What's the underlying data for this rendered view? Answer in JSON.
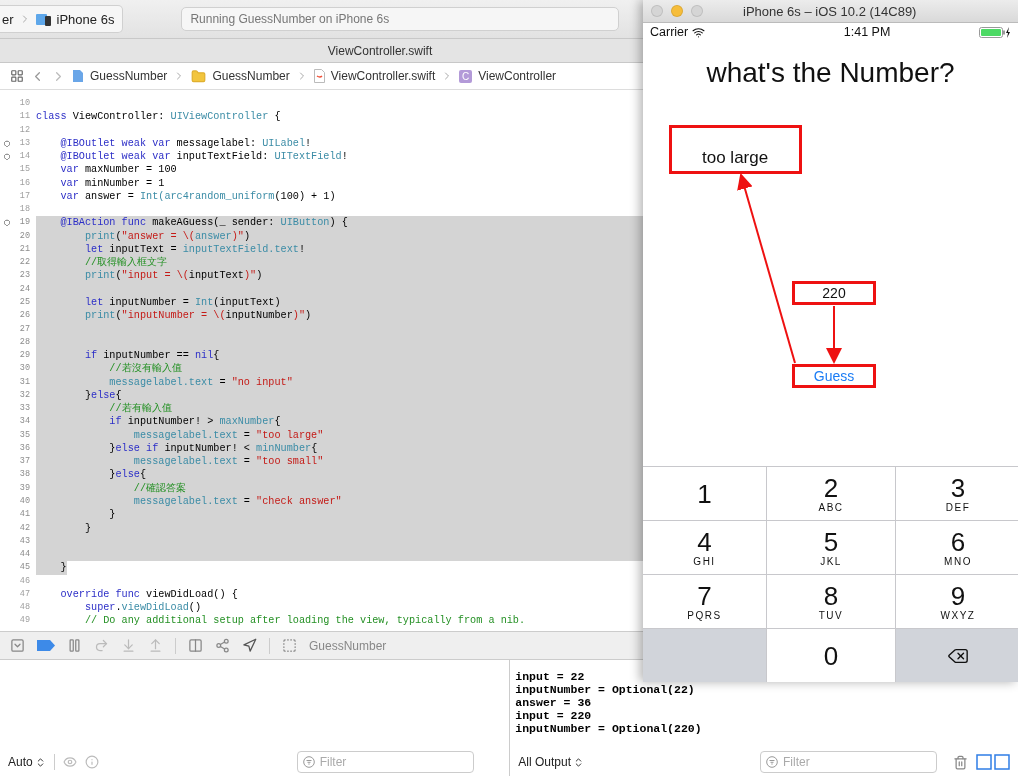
{
  "xcode": {
    "toolbar": {
      "scheme": [
        {
          "kind": "text",
          "label": "er"
        },
        {
          "kind": "device",
          "label": "iPhone 6s"
        }
      ],
      "activity": "Running GuessNumber on iPhone 6s"
    },
    "tab_title": "ViewController.swift",
    "jump_bar": [
      {
        "kind": "project",
        "label": "GuessNumber"
      },
      {
        "kind": "folder",
        "label": "GuessNumber"
      },
      {
        "kind": "file",
        "label": "ViewController.swift"
      },
      {
        "kind": "class",
        "label": "ViewController",
        "symbol": "C"
      }
    ],
    "editor": {
      "lines": [
        {
          "n": "10",
          "marker": false,
          "selected": false
        },
        {
          "n": "11",
          "marker": false,
          "selected": false,
          "tokens": [
            {
              "kind": "keyword",
              "t": "class"
            },
            {
              "kind": "plain",
              "t": " ViewController: "
            },
            {
              "kind": "type",
              "t": "UIViewController"
            },
            {
              "kind": "plain",
              "t": " {"
            }
          ]
        },
        {
          "n": "12",
          "marker": false,
          "selected": false
        },
        {
          "n": "13",
          "marker": true,
          "selected": false,
          "tokens": [
            {
              "kind": "keyword",
              "t": "    @IBOutlet weak var"
            },
            {
              "kind": "plain",
              "t": " messagelabel: "
            },
            {
              "kind": "type",
              "t": "UILabel"
            },
            {
              "kind": "plain",
              "t": "!"
            }
          ]
        },
        {
          "n": "14",
          "marker": true,
          "selected": false,
          "tokens": [
            {
              "kind": "keyword",
              "t": "    @IBOutlet weak var"
            },
            {
              "kind": "plain",
              "t": " inputTextField: "
            },
            {
              "kind": "type",
              "t": "UITextField"
            },
            {
              "kind": "plain",
              "t": "!"
            }
          ]
        },
        {
          "n": "15",
          "marker": false,
          "selected": false,
          "tokens": [
            {
              "kind": "keyword",
              "t": "    var"
            },
            {
              "kind": "plain",
              "t": " maxNumber = 100"
            }
          ]
        },
        {
          "n": "16",
          "marker": false,
          "selected": false,
          "tokens": [
            {
              "kind": "keyword",
              "t": "    var"
            },
            {
              "kind": "plain",
              "t": " minNumber = 1"
            }
          ]
        },
        {
          "n": "17",
          "marker": false,
          "selected": false,
          "tokens": [
            {
              "kind": "keyword",
              "t": "    var"
            },
            {
              "kind": "plain",
              "t": " answer = "
            },
            {
              "kind": "type",
              "t": "Int(arc4random_uniform"
            },
            {
              "kind": "plain",
              "t": "(100) + 1)"
            }
          ]
        },
        {
          "n": "18",
          "marker": false,
          "selected": false
        },
        {
          "n": "19",
          "marker": true,
          "selected": true,
          "tokens": [
            {
              "kind": "keyword",
              "t": "    @IBAction func"
            },
            {
              "kind": "plain",
              "t": " makeAGuess(_ sender: "
            },
            {
              "kind": "type",
              "t": "UIButton"
            },
            {
              "kind": "plain",
              "t": ") {"
            }
          ]
        },
        {
          "n": "20",
          "marker": false,
          "selected": true,
          "tokens": [
            {
              "kind": "type",
              "t": "        print"
            },
            {
              "kind": "plain",
              "t": "("
            },
            {
              "kind": "string",
              "t": "\"answer = \\("
            },
            {
              "kind": "type",
              "t": "answer"
            },
            {
              "kind": "string",
              "t": ")\""
            },
            {
              "kind": "plain",
              "t": ")"
            }
          ]
        },
        {
          "n": "21",
          "marker": false,
          "selected": true,
          "tokens": [
            {
              "kind": "keyword",
              "t": "        let"
            },
            {
              "kind": "plain",
              "t": " inputText = "
            },
            {
              "kind": "type",
              "t": "inputTextField.text"
            },
            {
              "kind": "plain",
              "t": "!"
            }
          ]
        },
        {
          "n": "22",
          "marker": false,
          "selected": true,
          "tokens": [
            {
              "kind": "comment",
              "t": "        //取得輸入框文字"
            }
          ]
        },
        {
          "n": "23",
          "marker": false,
          "selected": true,
          "tokens": [
            {
              "kind": "type",
              "t": "        print"
            },
            {
              "kind": "plain",
              "t": "("
            },
            {
              "kind": "string",
              "t": "\"input = \\("
            },
            {
              "kind": "plain",
              "t": "inputText"
            },
            {
              "kind": "string",
              "t": ")\""
            },
            {
              "kind": "plain",
              "t": ")"
            }
          ]
        },
        {
          "n": "24",
          "marker": false,
          "selected": true
        },
        {
          "n": "25",
          "marker": false,
          "selected": true,
          "tokens": [
            {
              "kind": "keyword",
              "t": "        let"
            },
            {
              "kind": "plain",
              "t": " inputNumber = "
            },
            {
              "kind": "type",
              "t": "Int"
            },
            {
              "kind": "plain",
              "t": "(inputText)"
            }
          ]
        },
        {
          "n": "26",
          "marker": false,
          "selected": true,
          "tokens": [
            {
              "kind": "type",
              "t": "        print"
            },
            {
              "kind": "plain",
              "t": "("
            },
            {
              "kind": "string",
              "t": "\"inputNumber = \\("
            },
            {
              "kind": "plain",
              "t": "inputNumber"
            },
            {
              "kind": "string",
              "t": ")\""
            },
            {
              "kind": "plain",
              "t": ")"
            }
          ]
        },
        {
          "n": "27",
          "marker": false,
          "selected": true
        },
        {
          "n": "28",
          "marker": false,
          "selected": true
        },
        {
          "n": "29",
          "marker": false,
          "selected": true,
          "tokens": [
            {
              "kind": "keyword",
              "t": "        if"
            },
            {
              "kind": "plain",
              "t": " inputNumber == "
            },
            {
              "kind": "keyword",
              "t": "nil"
            },
            {
              "kind": "plain",
              "t": "{"
            }
          ]
        },
        {
          "n": "30",
          "marker": false,
          "selected": true,
          "tokens": [
            {
              "kind": "comment",
              "t": "            //若沒有輸入值"
            }
          ]
        },
        {
          "n": "31",
          "marker": false,
          "selected": true,
          "tokens": [
            {
              "kind": "type",
              "t": "            messagelabel.text"
            },
            {
              "kind": "plain",
              "t": " = "
            },
            {
              "kind": "string",
              "t": "\"no input\""
            }
          ]
        },
        {
          "n": "32",
          "marker": false,
          "selected": true,
          "tokens": [
            {
              "kind": "plain",
              "t": "        }"
            },
            {
              "kind": "keyword",
              "t": "else"
            },
            {
              "kind": "plain",
              "t": "{"
            }
          ]
        },
        {
          "n": "33",
          "marker": false,
          "selected": true,
          "tokens": [
            {
              "kind": "comment",
              "t": "            //若有輸入值"
            }
          ]
        },
        {
          "n": "34",
          "marker": false,
          "selected": true,
          "tokens": [
            {
              "kind": "keyword",
              "t": "            if"
            },
            {
              "kind": "plain",
              "t": " inputNumber! > "
            },
            {
              "kind": "type",
              "t": "maxNumber"
            },
            {
              "kind": "plain",
              "t": "{"
            }
          ]
        },
        {
          "n": "35",
          "marker": false,
          "selected": true,
          "tokens": [
            {
              "kind": "type",
              "t": "                messagelabel.text"
            },
            {
              "kind": "plain",
              "t": " = "
            },
            {
              "kind": "string",
              "t": "\"too large\""
            }
          ]
        },
        {
          "n": "36",
          "marker": false,
          "selected": true,
          "tokens": [
            {
              "kind": "plain",
              "t": "            }"
            },
            {
              "kind": "keyword",
              "t": "else if"
            },
            {
              "kind": "plain",
              "t": " inputNumber! < "
            },
            {
              "kind": "type",
              "t": "minNumber"
            },
            {
              "kind": "plain",
              "t": "{"
            }
          ]
        },
        {
          "n": "37",
          "marker": false,
          "selected": true,
          "tokens": [
            {
              "kind": "type",
              "t": "                messagelabel.text"
            },
            {
              "kind": "plain",
              "t": " = "
            },
            {
              "kind": "string",
              "t": "\"too small\""
            }
          ]
        },
        {
          "n": "38",
          "marker": false,
          "selected": true,
          "tokens": [
            {
              "kind": "plain",
              "t": "            }"
            },
            {
              "kind": "keyword",
              "t": "else"
            },
            {
              "kind": "plain",
              "t": "{"
            }
          ]
        },
        {
          "n": "39",
          "marker": false,
          "selected": true,
          "tokens": [
            {
              "kind": "comment",
              "t": "                //確認答案"
            }
          ]
        },
        {
          "n": "40",
          "marker": false,
          "selected": true,
          "tokens": [
            {
              "kind": "type",
              "t": "                messagelabel.text"
            },
            {
              "kind": "plain",
              "t": " = "
            },
            {
              "kind": "string",
              "t": "\"check answer\""
            }
          ]
        },
        {
          "n": "41",
          "marker": false,
          "selected": true,
          "tokens": [
            {
              "kind": "plain",
              "t": "            }"
            }
          ]
        },
        {
          "n": "42",
          "marker": false,
          "selected": true,
          "tokens": [
            {
              "kind": "plain",
              "t": "        }"
            }
          ]
        },
        {
          "n": "43",
          "marker": false,
          "selected": true
        },
        {
          "n": "44",
          "marker": false,
          "selected": true
        },
        {
          "n": "45",
          "marker": false,
          "selected": true,
          "partial": true,
          "tokens": [
            {
              "kind": "plain",
              "t": "    }"
            }
          ]
        },
        {
          "n": "46",
          "marker": false,
          "selected": false
        },
        {
          "n": "47",
          "marker": false,
          "selected": false,
          "tokens": [
            {
              "kind": "keyword",
              "t": "    override func"
            },
            {
              "kind": "plain",
              "t": " viewDidLoad() {"
            }
          ]
        },
        {
          "n": "48",
          "marker": false,
          "selected": false,
          "tokens": [
            {
              "kind": "keyword",
              "t": "        super"
            },
            {
              "kind": "plain",
              "t": "."
            },
            {
              "kind": "type",
              "t": "viewDidLoad"
            },
            {
              "kind": "plain",
              "t": "()"
            }
          ]
        },
        {
          "n": "49",
          "marker": false,
          "selected": false,
          "tokens": [
            {
              "kind": "comment",
              "t": "        // Do any additional setup after loading the view, typically from a nib."
            }
          ]
        }
      ]
    },
    "debug_bar": {
      "target": "GuessNumber"
    },
    "variables_pane": {
      "scope": "Auto",
      "filter_placeholder": "Filter"
    },
    "console": {
      "lines": [
        "input = 22",
        "inputNumber = Optional(22)",
        "answer = 36",
        "input = 220",
        "inputNumber = Optional(220)"
      ],
      "output": "All Output",
      "filter_placeholder": "Filter"
    }
  },
  "simulator": {
    "title": "iPhone 6s – iOS 10.2 (14C89)",
    "status": {
      "carrier": "Carrier",
      "time": "1:41 PM"
    },
    "app": {
      "title": "what's the Number?",
      "message": {
        "text": "too large",
        "annotated": true
      },
      "input": {
        "value": "220",
        "annotated": true
      },
      "button": {
        "label": "Guess",
        "annotated": true
      }
    },
    "keypad": [
      {
        "kind": "digit",
        "digit": "1"
      },
      {
        "kind": "digit",
        "digit": "2",
        "letters": "ABC"
      },
      {
        "kind": "digit",
        "digit": "3",
        "letters": "DEF"
      },
      {
        "kind": "digit",
        "digit": "4",
        "letters": "GHI"
      },
      {
        "kind": "digit",
        "digit": "5",
        "letters": "JKL"
      },
      {
        "kind": "digit",
        "digit": "6",
        "letters": "MNO"
      },
      {
        "kind": "digit",
        "digit": "7",
        "letters": "PQRS"
      },
      {
        "kind": "digit",
        "digit": "8",
        "letters": "TUV"
      },
      {
        "kind": "digit",
        "digit": "9",
        "letters": "WXYZ"
      },
      {
        "kind": "blank"
      },
      {
        "kind": "digit",
        "digit": "0"
      },
      {
        "kind": "delete"
      }
    ]
  }
}
